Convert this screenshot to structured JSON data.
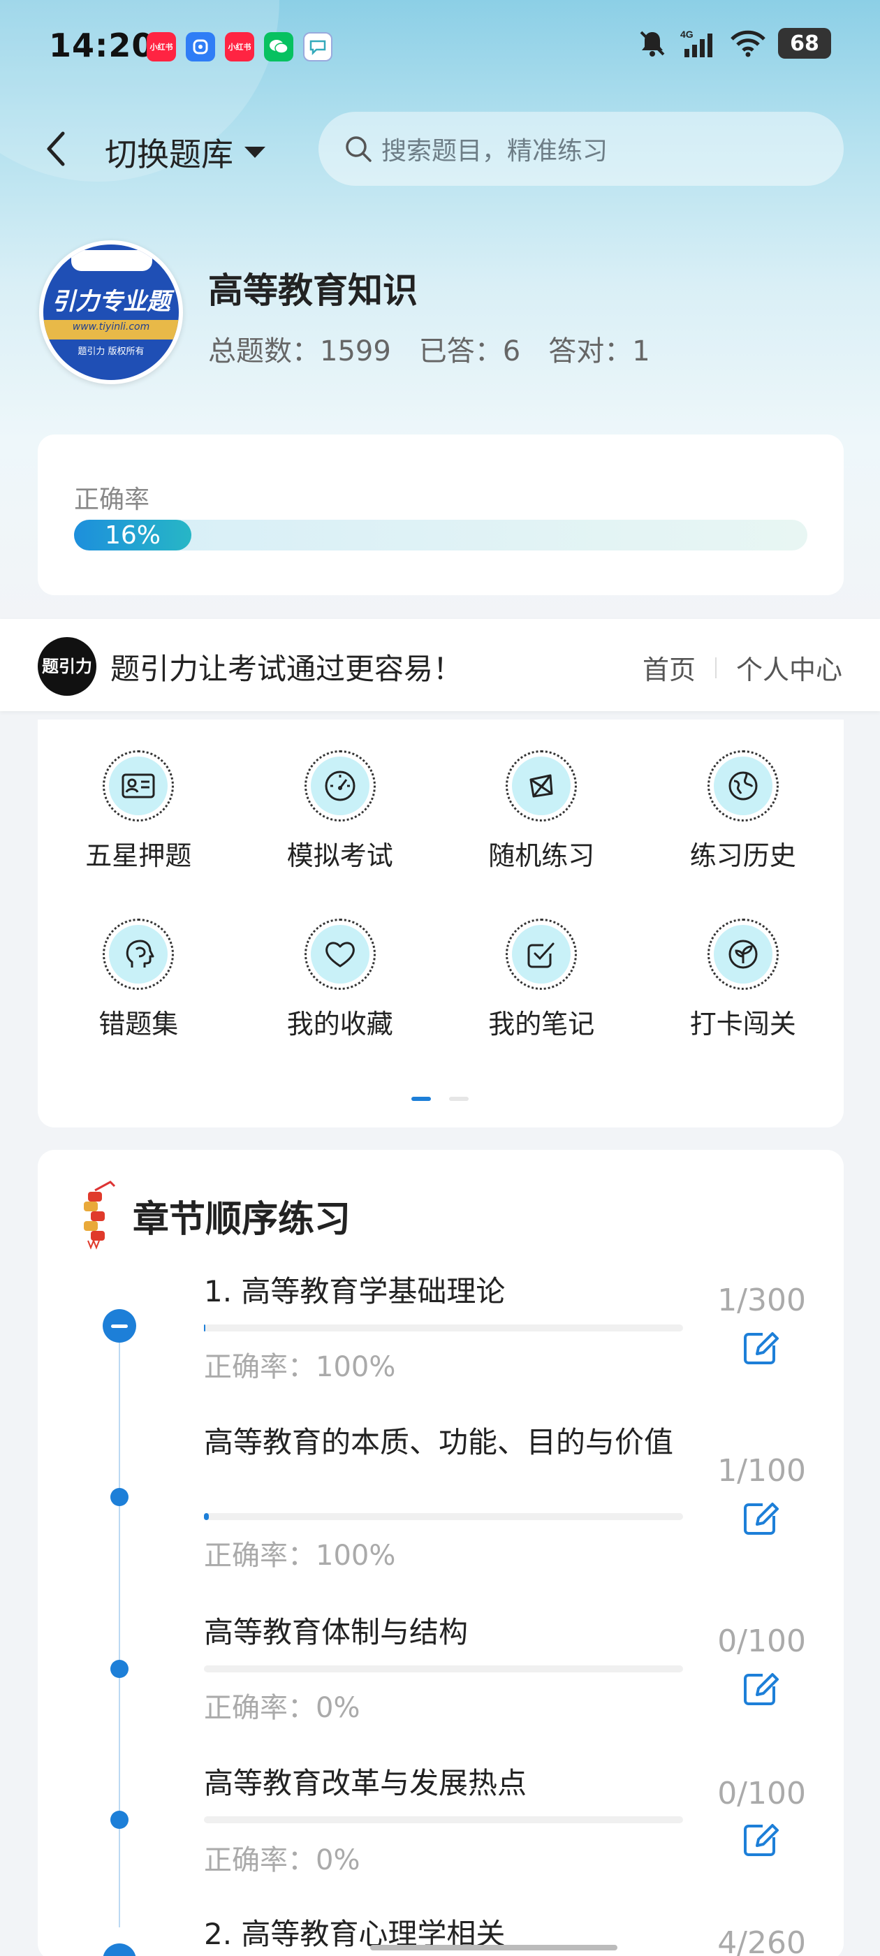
{
  "status_bar": {
    "time": "14:20",
    "notifications": [
      {
        "icon": "xiaohongshu-icon",
        "label": "小红书",
        "color": "#ff2442"
      },
      {
        "icon": "app-icon",
        "label": "",
        "color": "#2f7df6"
      },
      {
        "icon": "xiaohongshu-icon",
        "label": "小红书",
        "color": "#ff2442"
      },
      {
        "icon": "wechat-icon",
        "label": "",
        "color": "#07c160"
      },
      {
        "icon": "message-icon",
        "label": "",
        "color": "#ffffff"
      }
    ],
    "network": "4G",
    "battery": "68"
  },
  "header": {
    "switch_label": "切换题库",
    "search_placeholder": "搜索题目，精准练习"
  },
  "bank": {
    "logo_text": "引力专业题",
    "logo_url_text": "www.tiyinli.com",
    "logo_copyright": "题引力 版权所有",
    "title": "高等教育知识",
    "stats": [
      {
        "label": "总题数：1599"
      },
      {
        "label": "已答：6"
      },
      {
        "label": "答对：1"
      }
    ]
  },
  "accuracy": {
    "label": "正确率",
    "value_text": "16%",
    "fraction": 0.16
  },
  "banner": {
    "logo_text": "题引力",
    "slogan": "题引力让考试通过更容易！",
    "link_home": "首页",
    "link_profile": "个人中心"
  },
  "features": [
    {
      "label": "五星押题",
      "icon": "id-card-icon"
    },
    {
      "label": "模拟考试",
      "icon": "speedometer-icon"
    },
    {
      "label": "随机练习",
      "icon": "network-icon"
    },
    {
      "label": "练习历史",
      "icon": "globe-icon"
    },
    {
      "label": "错题集",
      "icon": "head-icon"
    },
    {
      "label": "我的收藏",
      "icon": "heart-icon"
    },
    {
      "label": "我的笔记",
      "icon": "checkbox-icon"
    },
    {
      "label": "打卡闯关",
      "icon": "leaf-icon"
    }
  ],
  "chapters_section": {
    "title": "章节顺序练习",
    "items": [
      {
        "name": "1. 高等教育学基础理论",
        "rate": "正确率：100%",
        "count": "1/300",
        "progress": 0.003,
        "collapse": true
      },
      {
        "name": "高等教育的本质、功能、目的与价值",
        "rate": "正确率：100%",
        "count": "1/100",
        "progress": 0.01,
        "collapse": false
      },
      {
        "name": "高等教育体制与结构",
        "rate": "正确率：0%",
        "count": "0/100",
        "progress": 0,
        "collapse": false
      },
      {
        "name": "高等教育改革与发展热点",
        "rate": "正确率：0%",
        "count": "0/100",
        "progress": 0,
        "collapse": false
      },
      {
        "name": "2. 高等教育心理学相关",
        "rate": "",
        "count": "4/260",
        "progress": 0.015,
        "collapse": true
      }
    ]
  },
  "colors": {
    "accent": "#1d7fd8",
    "icon_bg": "#c9f1f8"
  }
}
